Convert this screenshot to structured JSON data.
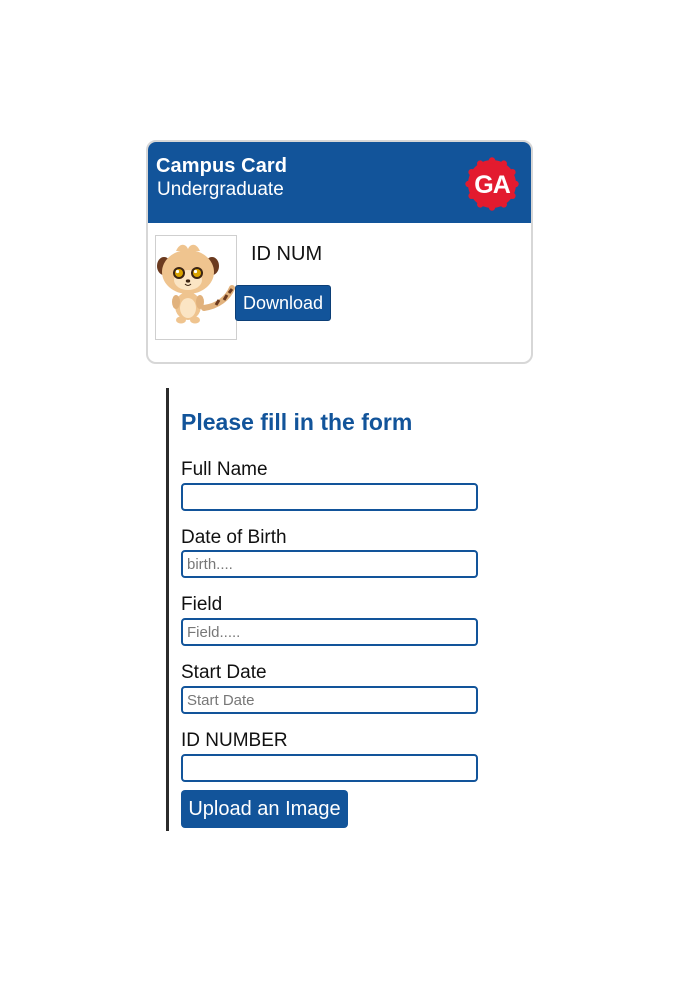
{
  "card": {
    "title": "Campus Card",
    "subtitle": "Undergraduate",
    "logo_text": "GA",
    "id_label": "ID NUM",
    "download_label": "Download",
    "colors": {
      "header": "#12549a",
      "logo": "#e31b2f"
    }
  },
  "form": {
    "heading": "Please fill in the form",
    "fields": [
      {
        "label": "Full Name",
        "placeholder": "",
        "value": ""
      },
      {
        "label": "Date of Birth",
        "placeholder": "birth....",
        "value": ""
      },
      {
        "label": "Field",
        "placeholder": "Field.....",
        "value": ""
      },
      {
        "label": "Start Date",
        "placeholder": "Start Date",
        "value": ""
      },
      {
        "label": "ID NUMBER",
        "placeholder": "",
        "value": ""
      }
    ],
    "upload_label": "Upload an Image"
  }
}
